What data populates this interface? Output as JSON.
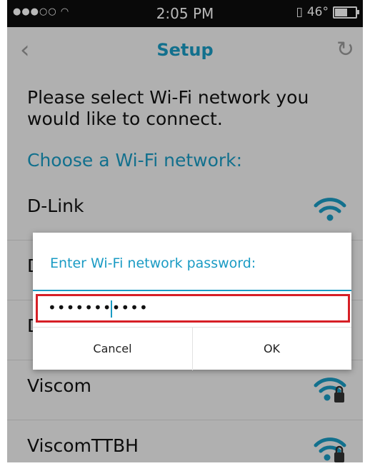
{
  "status_bar": {
    "signal": "●●●○○",
    "time": "2:05 PM",
    "temperature": "46°"
  },
  "nav": {
    "title": "Setup"
  },
  "content": {
    "intro": "Please select Wi-Fi network you would like to connect.",
    "choose_label": "Choose a Wi-Fi network:"
  },
  "networks": [
    {
      "name": "D-Link",
      "locked": false
    },
    {
      "name": "D",
      "locked": true
    },
    {
      "name": "D",
      "locked": true
    },
    {
      "name": "Viscom",
      "locked": true
    },
    {
      "name": "ViscomTTBH",
      "locked": true
    }
  ],
  "dialog": {
    "prompt": "Enter Wi-Fi network password:",
    "password_value": "•••••••••••",
    "cancel_label": "Cancel",
    "ok_label": "OK"
  },
  "colors": {
    "accent": "#1a9bc4",
    "highlight": "#d61f26"
  }
}
